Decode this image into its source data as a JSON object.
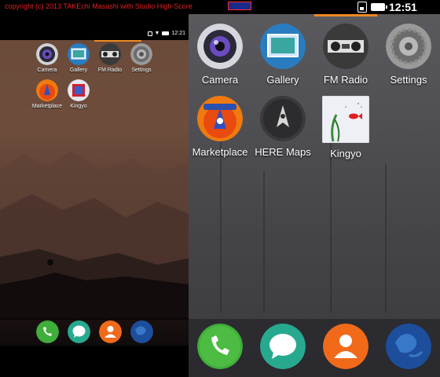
{
  "watermark": {
    "copyright": "copyright (c) 2013 TAKEchi Masashi with Studio High-Score",
    "logo_text": "STUDIO HIGHSCORE"
  },
  "small_phone": {
    "status_bar": {
      "time": "12:21"
    },
    "apps": [
      {
        "id": "camera",
        "label": "Camera",
        "icon": "camera-icon"
      },
      {
        "id": "gallery",
        "label": "Gallery",
        "icon": "gallery-icon"
      },
      {
        "id": "fm-radio",
        "label": "FM Radio",
        "icon": "radio-icon"
      },
      {
        "id": "settings",
        "label": "Settings",
        "icon": "gear-icon"
      },
      {
        "id": "marketplace",
        "label": "Marketplace",
        "icon": "marketplace-icon"
      },
      {
        "id": "kingyo",
        "label": "Kingyo",
        "icon": "kingyo-icon"
      }
    ],
    "dock": [
      "phone-icon",
      "messages-icon",
      "contacts-icon",
      "browser-icon"
    ]
  },
  "large_phone": {
    "status_bar": {
      "time": "12:51"
    },
    "apps": [
      {
        "id": "camera",
        "label": "Camera",
        "icon": "camera-icon"
      },
      {
        "id": "gallery",
        "label": "Gallery",
        "icon": "gallery-icon"
      },
      {
        "id": "fm-radio",
        "label": "FM Radio",
        "icon": "radio-icon"
      },
      {
        "id": "settings",
        "label": "Settings",
        "icon": "gear-icon"
      },
      {
        "id": "marketplace",
        "label": "Marketplace",
        "icon": "marketplace-icon"
      },
      {
        "id": "here-maps",
        "label": "HERE Maps",
        "icon": "maps-icon"
      },
      {
        "id": "kingyo",
        "label": "Kingyo",
        "icon": "kingyo-icon"
      }
    ],
    "dock": [
      "phone-icon",
      "messages-icon",
      "contacts-icon",
      "browser-icon"
    ]
  },
  "colors": {
    "accent": "#f08a24",
    "watermark": "#e02020",
    "phone_green": "#3fae3a",
    "messages_teal": "#27a98f",
    "contacts_orange": "#f06a1a",
    "browser_blue": "#1d4e9c"
  }
}
